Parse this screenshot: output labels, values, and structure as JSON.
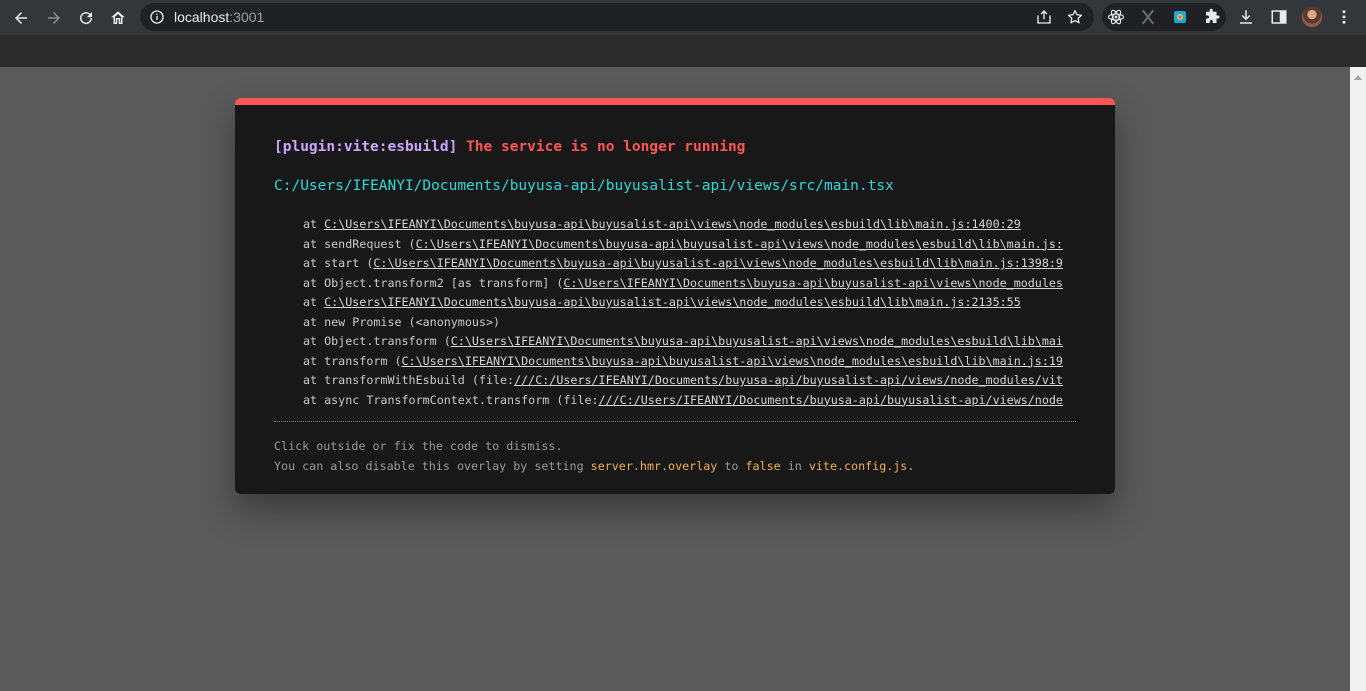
{
  "browser": {
    "url_host": "localhost",
    "url_port": ":3001"
  },
  "overlay": {
    "plugin": "[plugin:vite:esbuild]",
    "message": "The service is no longer running",
    "file": "C:/Users/IFEANYI/Documents/buyusa-api/buyusalist-api/views/src/main.tsx",
    "stack": [
      {
        "prefix": "at ",
        "link": "C:\\Users\\IFEANYI\\Documents\\buyusa-api\\buyusalist-api\\views\\node_modules\\esbuild\\lib\\main.js:1400:29",
        "suffix": ""
      },
      {
        "prefix": "at sendRequest (",
        "link": "C:\\Users\\IFEANYI\\Documents\\buyusa-api\\buyusalist-api\\views\\node_modules\\esbuild\\lib\\main.js:",
        "suffix": ""
      },
      {
        "prefix": "at start (",
        "link": "C:\\Users\\IFEANYI\\Documents\\buyusa-api\\buyusalist-api\\views\\node_modules\\esbuild\\lib\\main.js:1398:9",
        "suffix": ""
      },
      {
        "prefix": "at Object.transform2 [as transform] (",
        "link": "C:\\Users\\IFEANYI\\Documents\\buyusa-api\\buyusalist-api\\views\\node_modules",
        "suffix": ""
      },
      {
        "prefix": "at ",
        "link": "C:\\Users\\IFEANYI\\Documents\\buyusa-api\\buyusalist-api\\views\\node_modules\\esbuild\\lib\\main.js:2135:55",
        "suffix": ""
      },
      {
        "prefix": "at new Promise (<anonymous>)",
        "link": "",
        "suffix": ""
      },
      {
        "prefix": "at Object.transform (",
        "link": "C:\\Users\\IFEANYI\\Documents\\buyusa-api\\buyusalist-api\\views\\node_modules\\esbuild\\lib\\mai",
        "suffix": ""
      },
      {
        "prefix": "at transform (",
        "link": "C:\\Users\\IFEANYI\\Documents\\buyusa-api\\buyusalist-api\\views\\node_modules\\esbuild\\lib\\main.js:19",
        "suffix": ""
      },
      {
        "prefix": "at transformWithEsbuild (file:",
        "link": "///C:/Users/IFEANYI/Documents/buyusa-api/buyusalist-api/views/node_modules/vit",
        "suffix": ""
      },
      {
        "prefix": "at async TransformContext.transform (file:",
        "link": "///C:/Users/IFEANYI/Documents/buyusa-api/buyusalist-api/views/node",
        "suffix": ""
      }
    ],
    "tip_line1": "Click outside or fix the code to dismiss.",
    "tip_line2_a": "You can also disable this overlay by setting ",
    "tip_line2_code1": "server.hmr.overlay",
    "tip_line2_b": " to ",
    "tip_line2_code2": "false",
    "tip_line2_c": " in ",
    "tip_line2_code3": "vite.config.js."
  },
  "icons": {
    "back": "arrow-left-icon",
    "forward": "arrow-right-icon",
    "reload": "reload-icon",
    "home": "home-icon",
    "info": "info-icon",
    "share": "share-icon",
    "bookmark": "star-icon",
    "extensions": [
      "react-devtools-icon",
      "x-extension-icon",
      "color-picker-extension-icon",
      "puzzle-icon"
    ],
    "download": "download-icon",
    "side_panel": "side-panel-icon",
    "menu": "kebab-menu-icon"
  },
  "colors": {
    "overlay_accent": "#ff5555",
    "plugin": "#cfa4ff",
    "file": "#2dd9da",
    "code": "#f0b054"
  }
}
